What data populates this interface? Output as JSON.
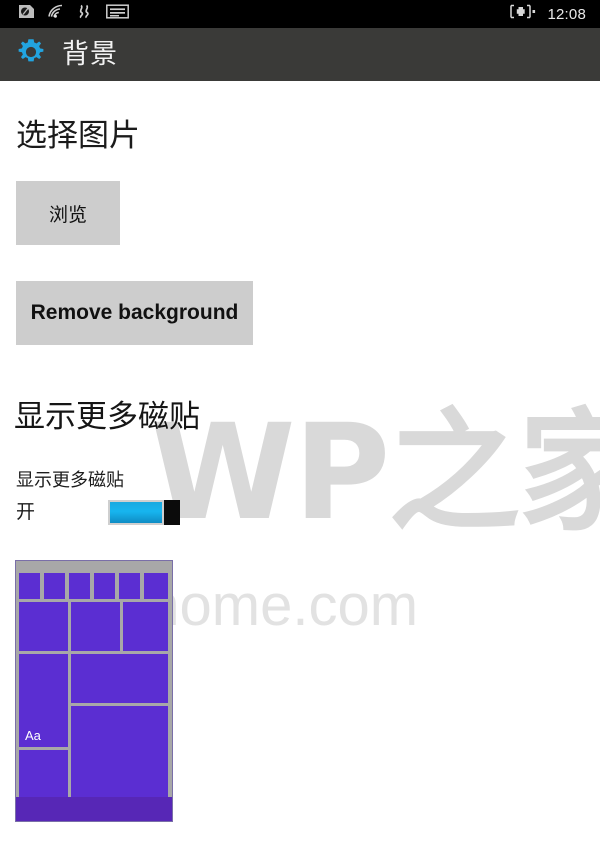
{
  "status_bar": {
    "icons": [
      "sim-card-icon",
      "wifi-signal-icon",
      "vibrate-mode-icon",
      "list-menu-icon"
    ],
    "battery_icon": "battery-charging-icon",
    "clock": "12:08"
  },
  "header": {
    "icon": "gear-icon",
    "title": "背景"
  },
  "watermark": {
    "primary": "WP之家",
    "secondary": "wp.ithome.com"
  },
  "main": {
    "pick_image_section": {
      "title": "选择图片",
      "browse_button": "浏览",
      "remove_background_button": "Remove background"
    },
    "show_more_tiles_section": {
      "title": "显示更多磁贴",
      "toggle_label": "显示更多磁贴",
      "toggle_state": "开",
      "toggle_on": true
    },
    "start_preview": {
      "tile_text": "Aa",
      "tile_color": "#5b2ed2",
      "bottom_bar_color": "#5727b6",
      "background_color": "#a8a8a8",
      "small_tiles_top_row": 6
    }
  },
  "colors": {
    "status_bar_bg": "#000000",
    "header_bg": "#3a3a38",
    "header_icon": "#22a4e0",
    "page_bg": "#ffffff",
    "button_bg": "#cdcdcd",
    "toggle_accent": "#17b5ef",
    "toggle_thumb": "#0b0b0b"
  }
}
